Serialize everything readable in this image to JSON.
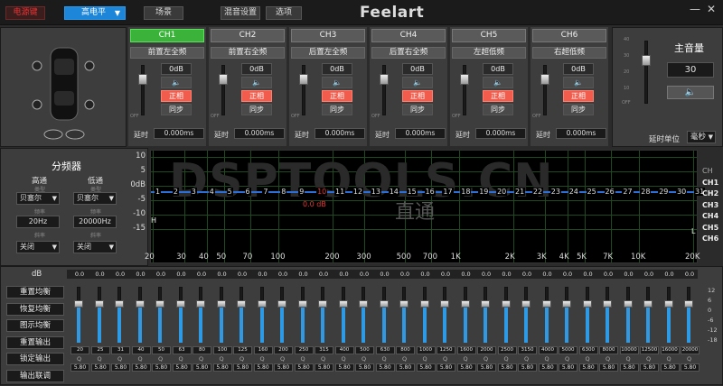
{
  "topbar": {
    "buttons": [
      {
        "label": "电源键",
        "style": "red"
      },
      {
        "label": "高电平",
        "style": "blue"
      },
      {
        "label": "场景",
        "style": ""
      },
      {
        "label": "混音设置",
        "style": ""
      },
      {
        "label": "选项",
        "style": ""
      }
    ],
    "logo": "Feelart",
    "win": {
      "min": "—",
      "close": "✕"
    }
  },
  "channels": [
    {
      "name": "CH1",
      "source": "前置左全频",
      "gain": "0dB",
      "phase": "正相",
      "sync": "同步",
      "delay": "0.000ms",
      "active": true
    },
    {
      "name": "CH2",
      "source": "前置右全频",
      "gain": "0dB",
      "phase": "正相",
      "sync": "同步",
      "delay": "0.000ms",
      "active": false
    },
    {
      "name": "CH3",
      "source": "后置左全频",
      "gain": "0dB",
      "phase": "正相",
      "sync": "同步",
      "delay": "0.000ms",
      "active": false
    },
    {
      "name": "CH4",
      "source": "后置右全频",
      "gain": "0dB",
      "phase": "正相",
      "sync": "同步",
      "delay": "0.000ms",
      "active": false
    },
    {
      "name": "CH5",
      "source": "左超低频",
      "gain": "0dB",
      "phase": "正相",
      "sync": "同步",
      "delay": "0.000ms",
      "active": false
    },
    {
      "name": "CH6",
      "source": "右超低频",
      "gain": "0dB",
      "phase": "正相",
      "sync": "同步",
      "delay": "0.000ms",
      "active": false
    }
  ],
  "channel_common": {
    "delay_label": "延时",
    "fader_ticks": [
      "",
      "",
      "",
      "",
      "OFF"
    ]
  },
  "master": {
    "title": "主音量",
    "value": "30",
    "ticks": [
      "40",
      "30",
      "20",
      "10",
      "OFF"
    ],
    "delay_unit_label": "延时单位",
    "delay_unit": "毫秒"
  },
  "crossover": {
    "title": "分频器",
    "hp": {
      "title": "高通",
      "type_label": "类型",
      "type": "贝塞尔",
      "freq_label": "频率",
      "freq": "20Hz",
      "slope_label": "斜率",
      "slope": "关闭"
    },
    "lp": {
      "title": "低通",
      "type_label": "类型",
      "type": "贝塞尔",
      "freq_label": "频率",
      "freq": "20000Hz",
      "slope_label": "斜率",
      "slope": "关闭"
    }
  },
  "chart_data": {
    "type": "line",
    "y_ticks": [
      "10",
      "5",
      "0dB",
      "-5",
      "-10",
      "-15"
    ],
    "ylim": [
      -20,
      10
    ],
    "x_ticks": [
      "20",
      "30",
      "40",
      "50",
      "70",
      "100",
      "200",
      "300",
      "500",
      "700",
      "1K",
      "2K",
      "3K",
      "4K",
      "5K",
      "7K",
      "10K",
      "20K"
    ],
    "band_labels": [
      "1",
      "2",
      "3",
      "4",
      "5",
      "6",
      "7",
      "8",
      "9",
      "10",
      "11",
      "12",
      "13",
      "14",
      "15",
      "16",
      "17",
      "18",
      "19",
      "20",
      "21",
      "22",
      "23",
      "24",
      "25",
      "26",
      "27",
      "28",
      "29",
      "30",
      "31"
    ],
    "selected_band": "10",
    "selected_value": "0.0 dB",
    "curve_value_db": 0,
    "watermark": "DSPTOOLS.CN",
    "mode": "直通",
    "left_marker": "H",
    "right_marker": "L",
    "ch_labels": [
      "CH",
      "CH1",
      "CH2",
      "CH3",
      "CH4",
      "CH5",
      "CH6"
    ]
  },
  "eq": {
    "db_label": "dB",
    "gains": [
      "0.0",
      "0.0",
      "0.0",
      "0.0",
      "0.0",
      "0.0",
      "0.0",
      "0.0",
      "0.0",
      "0.0",
      "0.0",
      "0.0",
      "0.0",
      "0.0",
      "0.0",
      "0.0",
      "0.0",
      "0.0",
      "0.0",
      "0.0",
      "0.0",
      "0.0",
      "0.0",
      "0.0",
      "0.0",
      "0.0",
      "0.0",
      "0.0",
      "0.0",
      "0.0",
      "0.0"
    ],
    "freqs": [
      "20",
      "25",
      "31",
      "40",
      "50",
      "63",
      "80",
      "100",
      "125",
      "160",
      "200",
      "250",
      "315",
      "400",
      "500",
      "630",
      "800",
      "1000",
      "1250",
      "1600",
      "2000",
      "2500",
      "3150",
      "4000",
      "5000",
      "6300",
      "8000",
      "10000",
      "12500",
      "16000",
      "20000"
    ],
    "q_label": "Q",
    "qs": [
      "5.80",
      "5.80",
      "5.80",
      "5.80",
      "5.80",
      "5.80",
      "5.80",
      "5.80",
      "5.80",
      "5.80",
      "5.80",
      "5.80",
      "5.80",
      "5.80",
      "5.80",
      "5.80",
      "5.80",
      "5.80",
      "5.80",
      "5.80",
      "5.80",
      "5.80",
      "5.80",
      "5.80",
      "5.80",
      "5.80",
      "5.80",
      "5.80",
      "5.80",
      "5.80",
      "5.80"
    ],
    "scale": [
      "12",
      "6",
      "0",
      "-6",
      "-12",
      "-18"
    ],
    "actions": [
      "重置均衡",
      "恢复均衡",
      "图示均衡",
      "重置输出",
      "锁定输出",
      "输出联调"
    ]
  }
}
